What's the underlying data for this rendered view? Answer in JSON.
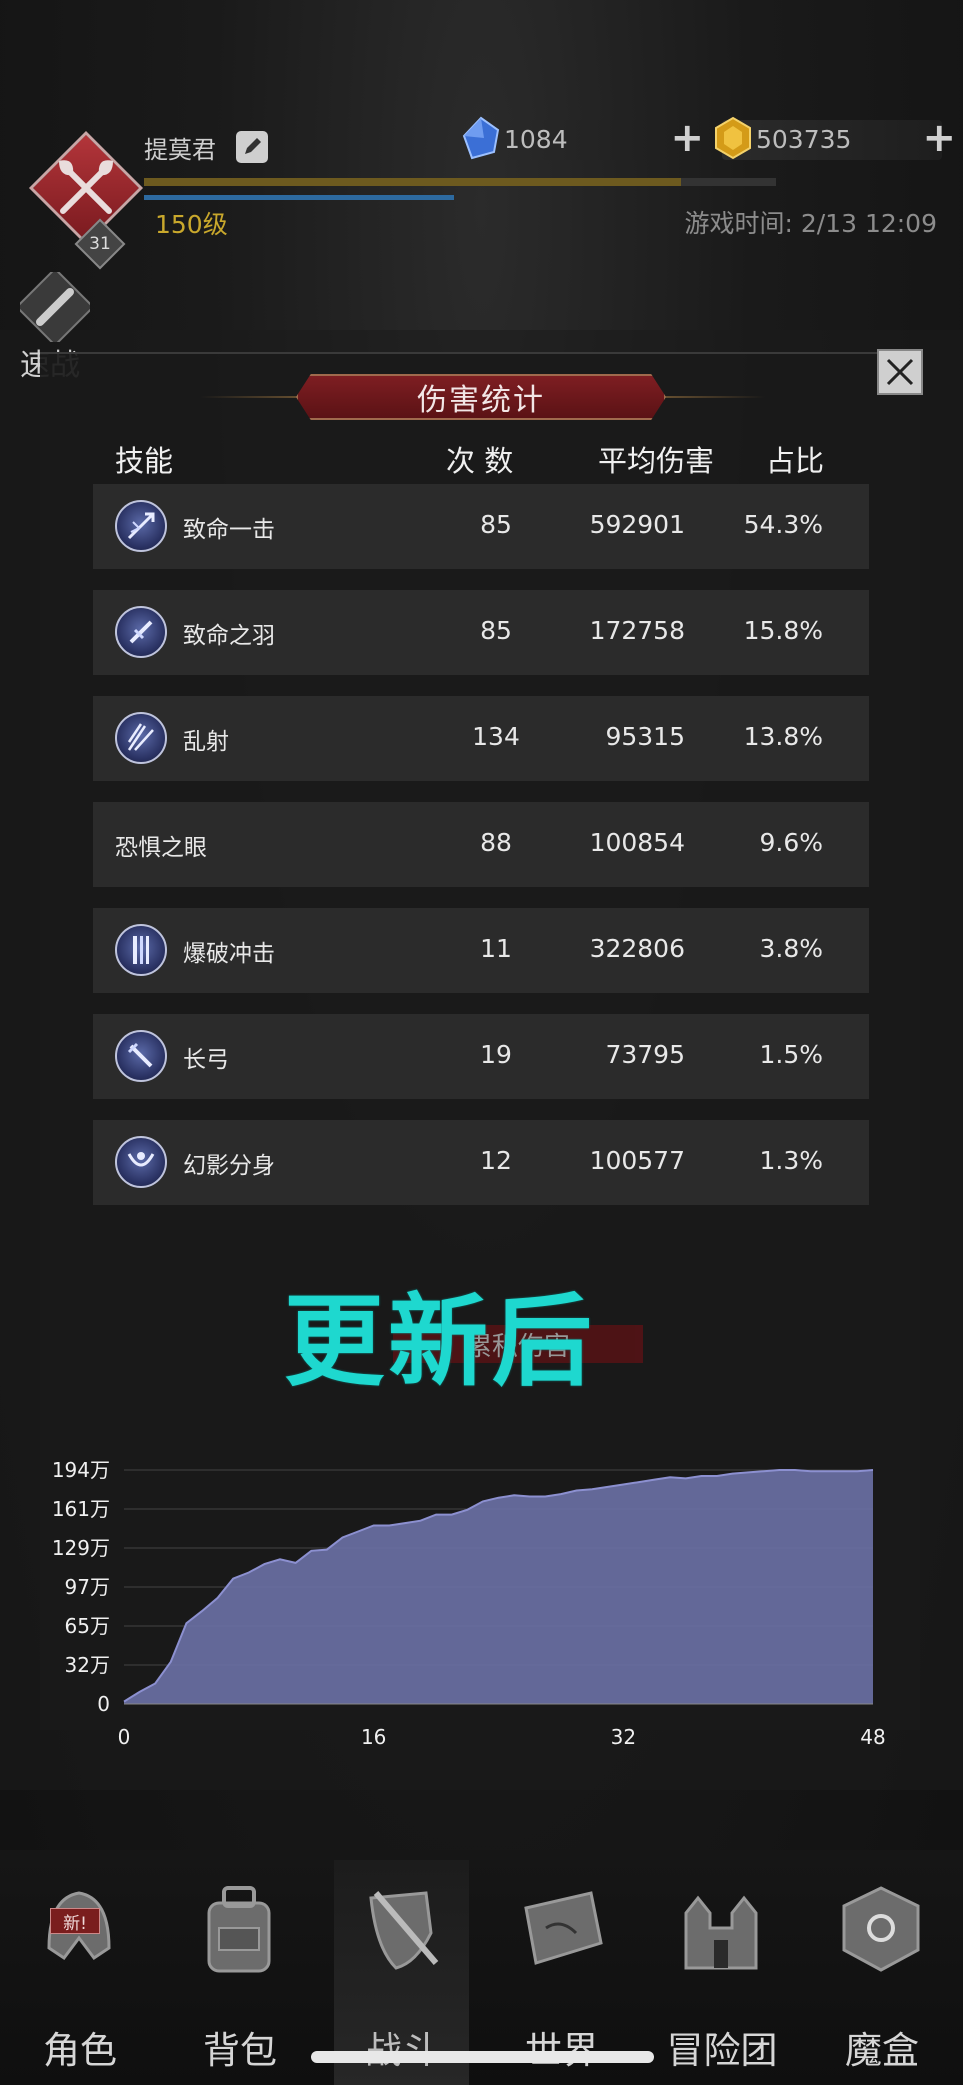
{
  "header": {
    "player_name": "提莫君",
    "player_level": "150级",
    "avatar_level_badge": "31",
    "xp_progress": 0.85,
    "gem_value": "1084",
    "gold_value": "503735",
    "game_time": "游戏时间: 2/13 12:09",
    "quick_fight_label": "速战"
  },
  "modal": {
    "title": "伤害统计",
    "columns": {
      "skill": "技能",
      "count": "次 数",
      "avg_damage": "平均伤害",
      "ratio": "占比"
    },
    "rows": [
      {
        "name": "致命一击",
        "count": "85",
        "avg": "592901",
        "ratio": "54.3%",
        "icon": "critical-strike-icon"
      },
      {
        "name": "致命之羽",
        "count": "85",
        "avg": "172758",
        "ratio": "15.8%",
        "icon": "deadly-feather-icon"
      },
      {
        "name": "乱射",
        "count": "134",
        "avg": "95315",
        "ratio": "13.8%",
        "icon": "scatter-shot-icon"
      },
      {
        "name": "恐惧之眼",
        "count": "88",
        "avg": "100854",
        "ratio": "9.6%",
        "icon": ""
      },
      {
        "name": "爆破冲击",
        "count": "11",
        "avg": "322806",
        "ratio": "3.8%",
        "icon": "blast-impact-icon"
      },
      {
        "name": "长弓",
        "count": "19",
        "avg": "73795",
        "ratio": "1.5%",
        "icon": "longbow-icon"
      },
      {
        "name": "幻影分身",
        "count": "12",
        "avg": "100577",
        "ratio": "1.3%",
        "icon": "phantom-clone-icon"
      }
    ],
    "overlay_text": "更新后",
    "sub_title_partial": "累积伤害"
  },
  "chart_data": {
    "type": "area",
    "title": "",
    "xlabel": "",
    "ylabel": "",
    "x_ticks": [
      "0",
      "16",
      "32",
      "48"
    ],
    "y_ticks": [
      "0",
      "32万",
      "65万",
      "97万",
      "129万",
      "161万",
      "194万"
    ],
    "xlim": [
      0,
      48
    ],
    "ylim": [
      0,
      194
    ],
    "series": [
      {
        "x": [
          0,
          1,
          2,
          3,
          4,
          5,
          6,
          7,
          8,
          9,
          10,
          11,
          12,
          13,
          14,
          15,
          16,
          17,
          18,
          19,
          20,
          21,
          22,
          23,
          24,
          25,
          26,
          27,
          28,
          29,
          30,
          31,
          32,
          33,
          34,
          35,
          36,
          37,
          38,
          39,
          40,
          41,
          42,
          43,
          44,
          45,
          46,
          47,
          48
        ],
        "y": [
          2,
          10,
          17,
          35,
          67,
          77,
          88,
          104,
          109,
          116,
          120,
          117,
          127,
          128,
          138,
          143,
          148,
          148,
          150,
          152,
          157,
          157,
          161,
          168,
          171,
          173,
          172,
          172,
          174,
          177,
          178,
          180,
          182,
          184,
          186,
          188,
          187,
          189,
          189,
          191,
          192,
          193,
          194,
          194,
          193,
          193,
          193,
          193,
          194
        ]
      }
    ],
    "colors": {
      "fill": "#6c71a6",
      "stroke": "#8c90d0",
      "grid": "#444444"
    },
    "grid": true
  },
  "nav": {
    "items": [
      {
        "label": "角色",
        "icon": "helmet-icon",
        "badge": "新!"
      },
      {
        "label": "背包",
        "icon": "backpack-icon"
      },
      {
        "label": "战斗",
        "icon": "sword-shield-icon"
      },
      {
        "label": "世界",
        "icon": "scroll-map-icon"
      },
      {
        "label": "冒险团",
        "icon": "castle-icon"
      },
      {
        "label": "魔盒",
        "icon": "magic-cube-icon"
      }
    ],
    "active_index": 2
  }
}
